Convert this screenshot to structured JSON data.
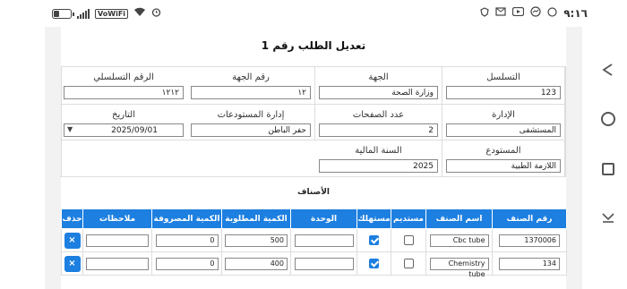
{
  "status_bar": {
    "time": "٩:١٦",
    "wifi_label": "VoWiFi",
    "battery_level": 0.35,
    "icons": [
      "battery-icon",
      "signal-icon",
      "wifi-icon",
      "alarm-icon",
      "shield-icon",
      "youtube-icon",
      "mail-icon",
      "messenger-icon"
    ]
  },
  "form": {
    "title": "تعديل الطلب رقم 1",
    "fields": {
      "sequence": {
        "label": "التسلسل",
        "value": "123"
      },
      "entity": {
        "label": "الجهة",
        "value": "وزارة الصحة"
      },
      "entity_number": {
        "label": "رقم الجهة",
        "value": "١٢"
      },
      "serial_number": {
        "label": "الرقم التسلسلي",
        "value": "١٢١٢"
      },
      "department": {
        "label": "الإدارة",
        "value": "المستشفى"
      },
      "page_count": {
        "label": "عدد الصفحات",
        "value": "2"
      },
      "warehouse_admin": {
        "label": "إدارة المستودعات",
        "value": "حفر الباطن"
      },
      "date": {
        "label": "التاريخ",
        "value": "2025/09/01"
      },
      "warehouse": {
        "label": "المستودع",
        "value": "اللازمة الطبية"
      },
      "fiscal_year": {
        "label": "السنة المالية",
        "value": "2025"
      }
    }
  },
  "items": {
    "section_title": "الأصناف",
    "columns": [
      "رقم الصنف",
      "اسم الصنف",
      "مستديم",
      "مستهلك",
      "الوحدة",
      "الكمية المطلوبة",
      "الكمية المصروفة",
      "ملاحظات",
      "حذف"
    ],
    "delete_label": "×",
    "rows": [
      {
        "item_no": "1370006",
        "item_name": "Cbc tube",
        "durable": false,
        "consumable": true,
        "unit": "",
        "requested": "500",
        "dispensed": "0",
        "notes": ""
      },
      {
        "item_no": "134",
        "item_name": "Chemistry tube",
        "durable": false,
        "consumable": true,
        "unit": "",
        "requested": "400",
        "dispensed": "0",
        "notes": ""
      }
    ]
  },
  "colors": {
    "accent": "#1d7fe0",
    "header_text": "#ffffff"
  }
}
